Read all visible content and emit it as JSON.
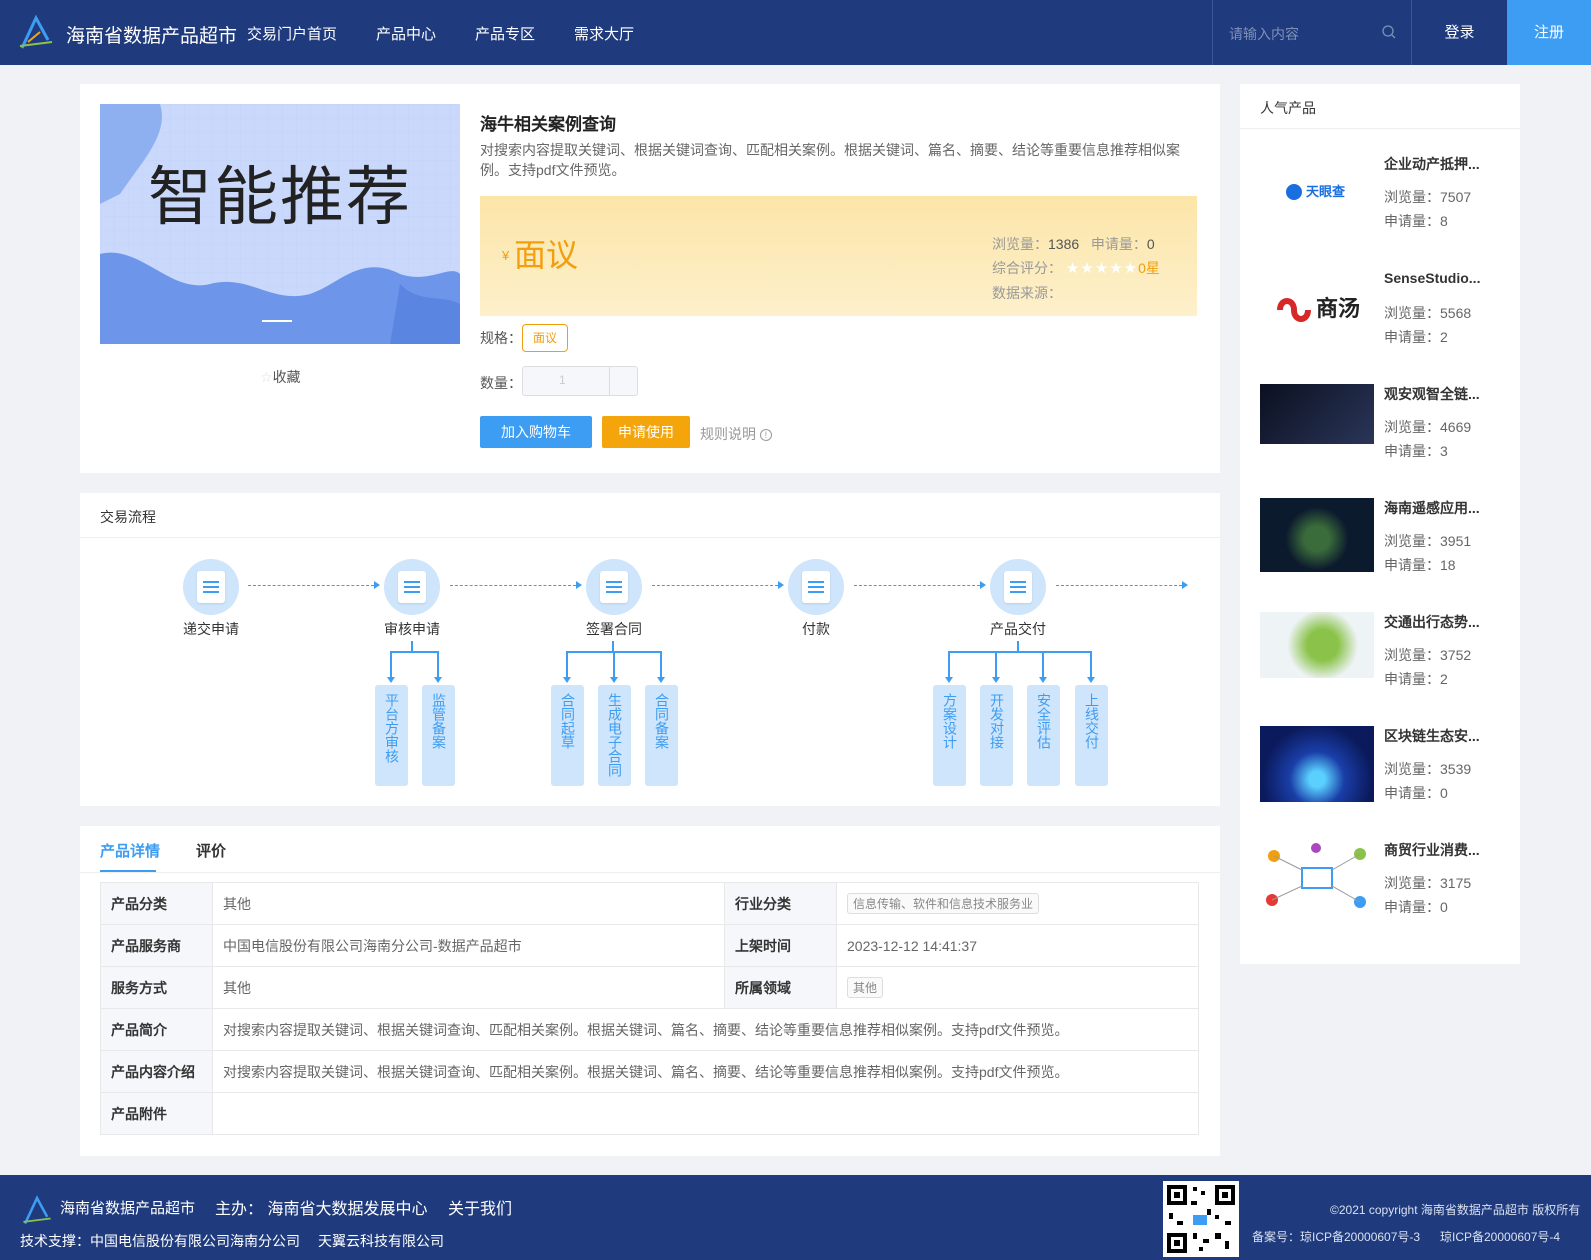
{
  "header": {
    "site_title": "海南省数据产品超市",
    "nav": [
      "交易门户首页",
      "产品中心",
      "产品专区",
      "需求大厅"
    ],
    "search_placeholder": "请输入内容",
    "login": "登录",
    "register": "注册"
  },
  "product": {
    "banner_text": "智能推荐",
    "favorite": "收藏",
    "title": "海牛相关案例查询",
    "description": "对搜索内容提取关键词、根据关键词查询、匹配相关案例。根据关键词、篇名、摘要、结论等重要信息推荐相似案例。支持pdf文件预览。",
    "currency": "¥",
    "price": "面议",
    "views_label": "浏览量：",
    "views": "1386",
    "applies_label": "申请量：",
    "applies": "0",
    "rating_label": "综合评分：",
    "stars": "★★★★★",
    "rating_value": "0星",
    "source_label": "数据来源：",
    "spec_label": "规格：",
    "spec_value": "面议",
    "qty_label": "数量：",
    "qty_value": "1",
    "add_cart": "加入购物车",
    "apply": "申请使用",
    "rules": "规则说明"
  },
  "flow": {
    "title": "交易流程",
    "steps": [
      "递交申请",
      "审核申请",
      "签署合同",
      "付款",
      "产品交付"
    ],
    "subs": [
      "平台方审核",
      "监管备案",
      "合同起草",
      "生成电子合同",
      "合同备案",
      "方案设计",
      "开发对接",
      "安全评估",
      "上线交付"
    ]
  },
  "detail": {
    "tabs": [
      "产品详情",
      "评价"
    ],
    "rows": [
      {
        "k1": "产品分类",
        "v1": "其他",
        "k2": "行业分类",
        "v2": "信息传输、软件和信息技术服务业"
      },
      {
        "k1": "产品服务商",
        "v1": "中国电信股份有限公司海南分公司-数据产品超市",
        "k2": "上架时间",
        "v2": "2023-12-12 14:41:37"
      },
      {
        "k1": "服务方式",
        "v1": "其他",
        "k2": "所属领域",
        "v2": "其他"
      }
    ],
    "intro_label": "产品简介",
    "intro": "对搜索内容提取关键词、根据关键词查询、匹配相关案例。根据关键词、篇名、摘要、结论等重要信息推荐相似案例。支持pdf文件预览。",
    "content_label": "产品内容介绍",
    "content": "对搜索内容提取关键词、根据关键词查询、匹配相关案例。根据关键词、篇名、摘要、结论等重要信息推荐相似案例。支持pdf文件预览。",
    "attach_label": "产品附件"
  },
  "hot": {
    "title": "人气产品",
    "views_label": "浏览量：",
    "applies_label": "申请量：",
    "items": [
      {
        "name": "企业动产抵押...",
        "views": "7507",
        "applies": "8",
        "thumb": "天眼查"
      },
      {
        "name": "SenseStudio...",
        "views": "5568",
        "applies": "2",
        "thumb": "商汤"
      },
      {
        "name": "观安观智全链...",
        "views": "4669",
        "applies": "3"
      },
      {
        "name": "海南遥感应用...",
        "views": "3951",
        "applies": "18"
      },
      {
        "name": "交通出行态势...",
        "views": "3752",
        "applies": "2"
      },
      {
        "name": "区块链生态安...",
        "views": "3539",
        "applies": "0"
      },
      {
        "name": "商贸行业消费...",
        "views": "3175",
        "applies": "0"
      }
    ]
  },
  "footer": {
    "title": "海南省数据产品超市",
    "host": "主办： 海南省大数据发展中心",
    "about": "关于我们",
    "tech": "技术支撑：中国电信股份有限公司海南分公司",
    "tech2": "天翼云科技有限公司",
    "copyright": "©2021 copyright 海南省数据产品超市 版权所有",
    "icp1": "备案号：琼ICP备20000607号-3",
    "icp2": "琼ICP备20000607号-4"
  }
}
